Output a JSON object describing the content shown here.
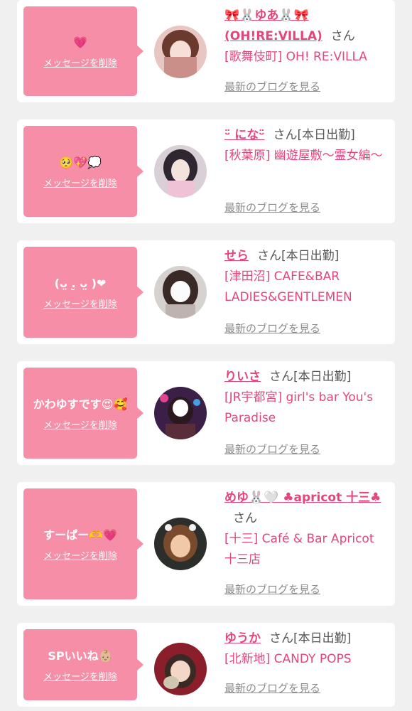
{
  "delete_label": "メッセージを削除",
  "blog_label": "最新のブログを見る",
  "colors": {
    "accent_pink": "#e5467a",
    "bubble_pink": "#f58ea6",
    "background": "#f0f0f0"
  },
  "cards": [
    {
      "message": "💗",
      "name": "🎀🐰ゆあ🐰🎀(OH!RE:VILLA)",
      "suffix": "さん",
      "shop": "[歌舞伎町] OH! RE:VILLA"
    },
    {
      "message": "🥺💖💭",
      "name": "ᵕ̈ になᵕ̈",
      "suffix": "さん[本日出勤]",
      "shop": "[秋葉原] 幽遊屋敷〜霊女編〜"
    },
    {
      "message": "(ᴗ̤ .̮ ᴗ̤ )❤",
      "name": "せら",
      "suffix": "さん[本日出勤]",
      "shop": "[津田沼] CAFE&BAR LADIES&GENTLEMEN"
    },
    {
      "message": "かわゆすです😍🥰",
      "name": "りいさ",
      "suffix": "さん[本日出勤]",
      "shop": "[JR宇都宮] girl's bar You's Paradise"
    },
    {
      "message": "すーぱー🫶💗",
      "name": "めゆ🐰🤍 ♣apricot 十三♣",
      "suffix": "さん",
      "shop": "[十三] Café & Bar Apricot 十三店"
    },
    {
      "message": "SPいいね👶🏼",
      "name": "ゆうか",
      "suffix": "さん[本日出勤]",
      "shop": "[北新地] CANDY POPS"
    }
  ]
}
